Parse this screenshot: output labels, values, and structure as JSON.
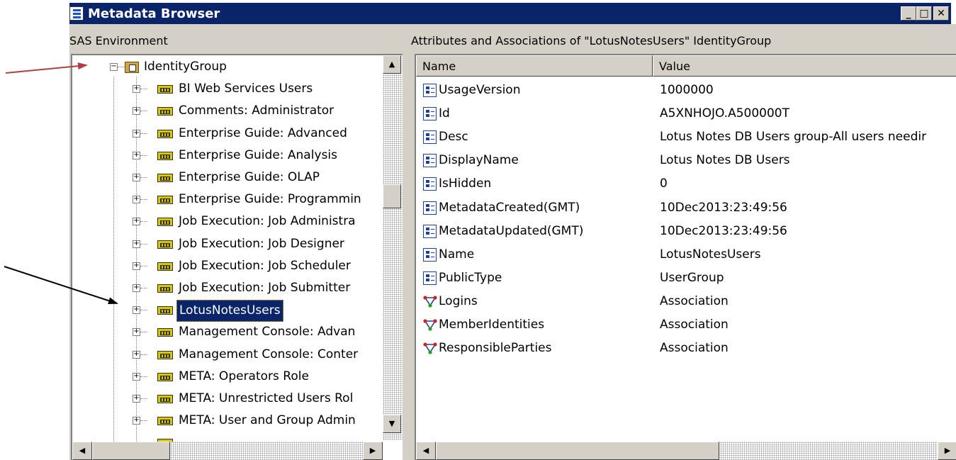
{
  "window": {
    "title": "Metadata Browser",
    "controls": {
      "minimize": "_",
      "maximize": "□",
      "close": "✕"
    }
  },
  "left_pane": {
    "caption": "SAS Environment",
    "root": {
      "label": "IdentityGroup",
      "expanded": true
    },
    "items": [
      {
        "label": "BI Web Services Users"
      },
      {
        "label": "Comments: Administrator"
      },
      {
        "label": "Enterprise Guide: Advanced"
      },
      {
        "label": "Enterprise Guide: Analysis"
      },
      {
        "label": "Enterprise Guide: OLAP"
      },
      {
        "label": "Enterprise Guide: Programmin"
      },
      {
        "label": "Job Execution: Job Administra"
      },
      {
        "label": "Job Execution: Job Designer"
      },
      {
        "label": "Job Execution: Job Scheduler"
      },
      {
        "label": "Job Execution: Job Submitter"
      },
      {
        "label": "LotusNotesUsers",
        "selected": true
      },
      {
        "label": "Management Console: Advan"
      },
      {
        "label": "Management Console: Conter"
      },
      {
        "label": "META: Operators Role"
      },
      {
        "label": "META: Unrestricted Users Rol"
      },
      {
        "label": "META: User and Group Admin"
      }
    ]
  },
  "right_pane": {
    "caption": "Attributes and Associations of \"LotusNotesUsers\" IdentityGroup",
    "columns": [
      "Name",
      "Value"
    ],
    "rows": [
      {
        "name": "UsageVersion",
        "value": "1000000",
        "kind": "attribute"
      },
      {
        "name": "Id",
        "value": "A5XNHOJO.A500000T",
        "kind": "attribute"
      },
      {
        "name": "Desc",
        "value": "Lotus Notes DB Users group-All users needir",
        "kind": "attribute"
      },
      {
        "name": "DisplayName",
        "value": "Lotus Notes DB Users",
        "kind": "attribute"
      },
      {
        "name": "IsHidden",
        "value": "0",
        "kind": "attribute"
      },
      {
        "name": "MetadataCreated(GMT)",
        "value": "10Dec2013:23:49:56",
        "kind": "attribute"
      },
      {
        "name": "MetadataUpdated(GMT)",
        "value": "10Dec2013:23:49:56",
        "kind": "attribute"
      },
      {
        "name": "Name",
        "value": "LotusNotesUsers",
        "kind": "attribute"
      },
      {
        "name": "PublicType",
        "value": "UserGroup",
        "kind": "attribute"
      },
      {
        "name": "Logins",
        "value": "Association",
        "kind": "association"
      },
      {
        "name": "MemberIdentities",
        "value": "Association",
        "kind": "association"
      },
      {
        "name": "ResponsibleParties",
        "value": "Association",
        "kind": "association"
      }
    ]
  },
  "icons": {
    "group": "group-icon",
    "folder": "identity-folder-icon",
    "attribute": "attribute-icon",
    "association": "association-icon"
  },
  "colors": {
    "title_bar": "#0a246a",
    "selection": "#0a246a",
    "annotation_arrow_red": "#b04040",
    "annotation_arrow_black": "#000000"
  }
}
